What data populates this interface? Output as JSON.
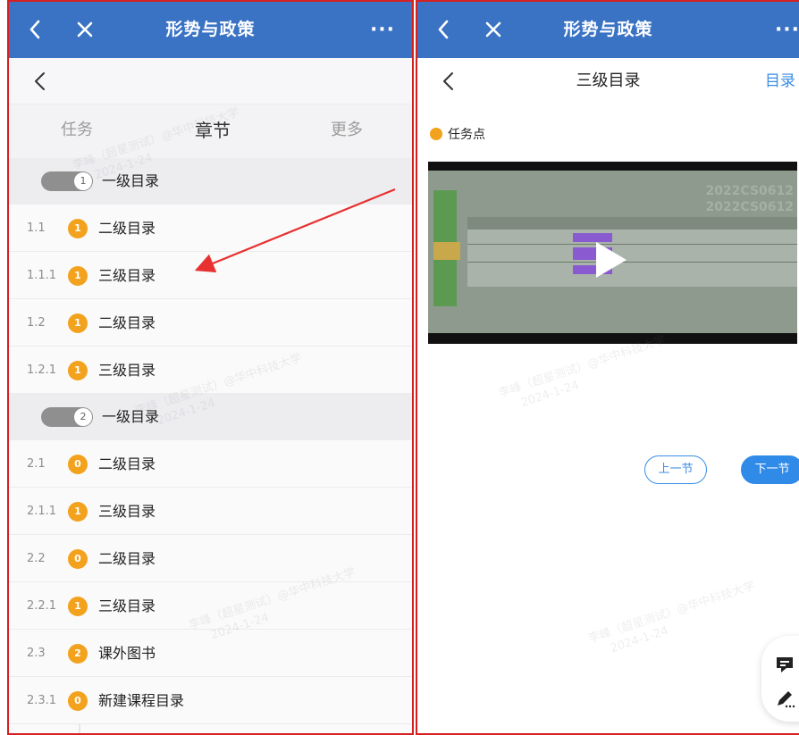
{
  "left": {
    "title": "形势与政策",
    "more": "···",
    "tabs": [
      "任务",
      "章节",
      "更多"
    ],
    "rows": [
      {
        "type": "lvl1",
        "index": "1",
        "label": "一级目录"
      },
      {
        "type": "item",
        "num": "1.1",
        "badge": "1",
        "label": "二级目录"
      },
      {
        "type": "item",
        "num": "1.1.1",
        "badge": "1",
        "label": "三级目录"
      },
      {
        "type": "item",
        "num": "1.2",
        "badge": "1",
        "label": "二级目录"
      },
      {
        "type": "item",
        "num": "1.2.1",
        "badge": "1",
        "label": "三级目录"
      },
      {
        "type": "lvl1",
        "index": "2",
        "label": "一级目录"
      },
      {
        "type": "item",
        "num": "2.1",
        "badge": "0",
        "label": "二级目录"
      },
      {
        "type": "item",
        "num": "2.1.1",
        "badge": "1",
        "label": "三级目录"
      },
      {
        "type": "item",
        "num": "2.2",
        "badge": "0",
        "label": "二级目录"
      },
      {
        "type": "item",
        "num": "2.2.1",
        "badge": "1",
        "label": "三级目录"
      },
      {
        "type": "item",
        "num": "2.3",
        "badge": "2",
        "label": "课外图书"
      },
      {
        "type": "item",
        "num": "2.3.1",
        "badge": "0",
        "label": "新建课程目录"
      }
    ]
  },
  "right": {
    "title": "形势与政策",
    "more": "···",
    "subtitle": "三级目录",
    "catalog_link": "目录",
    "task_point": "任务点",
    "video_code_1": "2022CS0612",
    "video_code_2": "2022CS0612",
    "prev": "上一节",
    "next": "下一节"
  },
  "watermark": {
    "line1": "李峰（超星测试）@华中科技大学",
    "line2": "2024-1-24"
  },
  "colors": {
    "appbar": "#3a73c4",
    "badge": "#f3a21d",
    "accent": "#2f8ae8",
    "border": "#d61f1f"
  }
}
